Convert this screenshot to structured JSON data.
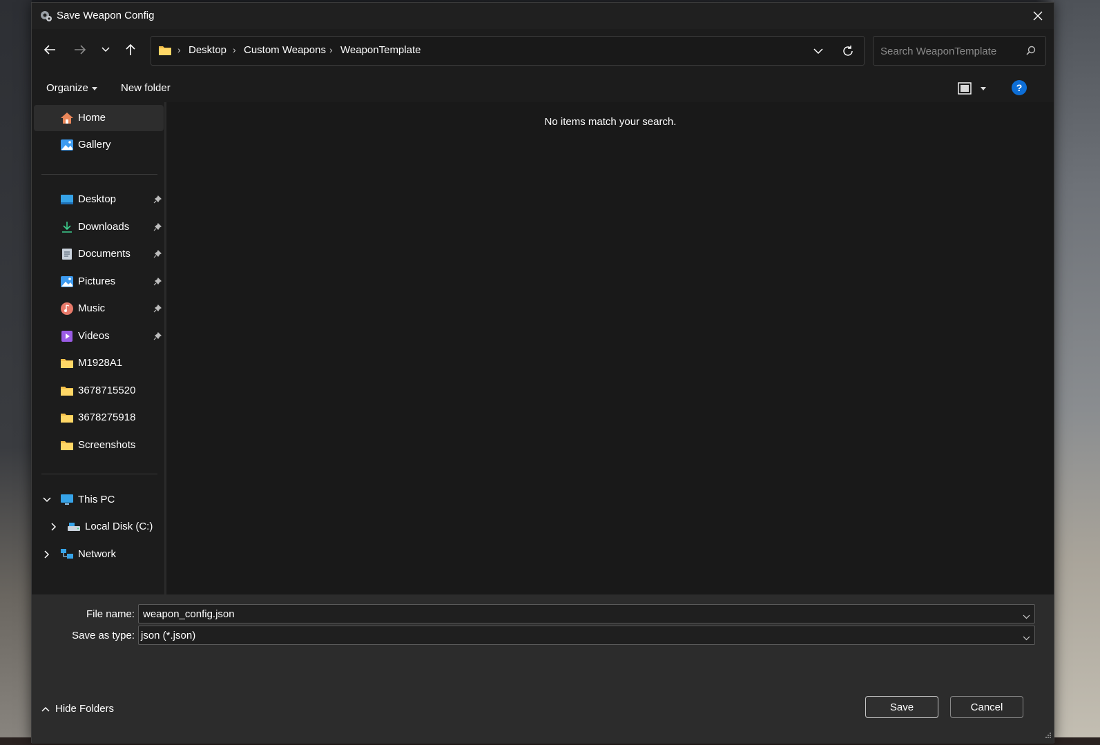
{
  "window": {
    "title": "Save Weapon Config",
    "title_icon": "app-gear-icon",
    "close_icon": "close-icon"
  },
  "nav": {
    "back_icon": "back-arrow-icon",
    "forward_icon": "forward-arrow-icon",
    "recent_icon": "chevron-down-icon",
    "up_icon": "up-arrow-icon",
    "breadcrumbs": [
      "Desktop",
      "Custom Weapons",
      "WeaponTemplate"
    ],
    "separator": "›",
    "search_placeholder": "Search WeaponTemplate"
  },
  "toolbar": {
    "organize": "Organize",
    "new_folder": "New folder",
    "help": "?"
  },
  "sidebar": {
    "quick": [
      {
        "label": "Home",
        "icon": "home-icon",
        "selected": true
      },
      {
        "label": "Gallery",
        "icon": "gallery-icon"
      }
    ],
    "pinned": [
      {
        "label": "Desktop",
        "icon": "desktop-icon",
        "pinned": true
      },
      {
        "label": "Downloads",
        "icon": "download-icon",
        "pinned": true
      },
      {
        "label": "Documents",
        "icon": "document-icon",
        "pinned": true
      },
      {
        "label": "Pictures",
        "icon": "pictures-icon",
        "pinned": true
      },
      {
        "label": "Music",
        "icon": "music-icon",
        "pinned": true
      },
      {
        "label": "Videos",
        "icon": "videos-icon",
        "pinned": true
      },
      {
        "label": "M1928A1",
        "icon": "folder-icon"
      },
      {
        "label": "3678715520",
        "icon": "folder-icon"
      },
      {
        "label": "3678275918",
        "icon": "folder-icon"
      },
      {
        "label": "Screenshots",
        "icon": "folder-icon"
      }
    ],
    "tree": [
      {
        "label": "This PC",
        "icon": "computer-icon",
        "expanded": true
      },
      {
        "label": "Local Disk (C:)",
        "icon": "disk-icon",
        "expanded": false
      },
      {
        "label": "Network",
        "icon": "network-icon",
        "expanded": false
      }
    ]
  },
  "content": {
    "empty_message": "No items match your search."
  },
  "footer": {
    "file_name_label": "File name:",
    "file_name_value": "weapon_config.json",
    "save_type_label": "Save as type:",
    "save_type_value": "json (*.json)",
    "hide_folders": "Hide Folders",
    "save": "Save",
    "cancel": "Cancel"
  },
  "colors": {
    "accent": "#0d6ed6",
    "folder": "#f5c04a",
    "background": "#202020"
  }
}
